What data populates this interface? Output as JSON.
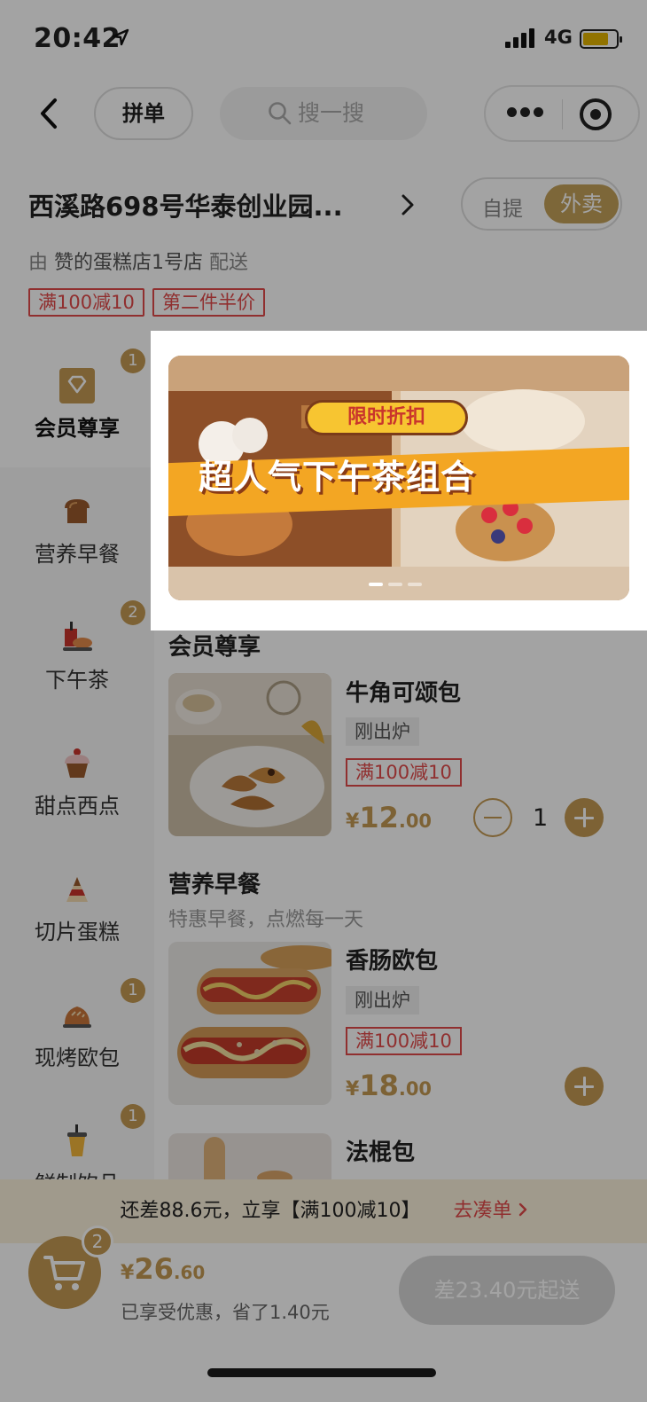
{
  "status_bar": {
    "time": "20:42",
    "network": "4G"
  },
  "nav": {
    "group_order_label": "拼单",
    "search_placeholder": "搜一搜"
  },
  "store": {
    "address": "西溪路698号华泰创业园...",
    "mode_self": "自提",
    "mode_delivery": "外卖",
    "delivery_prefix": "由",
    "shop_name": "赞的蛋糕店1号店",
    "delivery_suffix": "配送",
    "promos": [
      "满100减10",
      "第二件半价"
    ]
  },
  "banner": {
    "tag": "限时折扣",
    "headline": "超人气下午茶组合"
  },
  "categories": [
    {
      "label": "会员尊享",
      "badge": "1",
      "icon": "diamond-icon",
      "active": true
    },
    {
      "label": "营养早餐",
      "badge": "",
      "icon": "bread-icon",
      "active": false
    },
    {
      "label": "下午茶",
      "badge": "2",
      "icon": "afternoon-tea-icon",
      "active": false
    },
    {
      "label": "甜点西点",
      "badge": "",
      "icon": "cupcake-icon",
      "active": false
    },
    {
      "label": "切片蛋糕",
      "badge": "",
      "icon": "cake-slice-icon",
      "active": false
    },
    {
      "label": "现烤欧包",
      "badge": "1",
      "icon": "baked-bread-icon",
      "active": false
    },
    {
      "label": "鲜制饮品",
      "badge": "1",
      "icon": "drink-cup-icon",
      "active": false
    }
  ],
  "sections": [
    {
      "title": "会员尊享",
      "products": [
        {
          "name": "牛角可颂包",
          "tag": "刚出炉",
          "promo": "满100减10",
          "price_int": "12",
          "price_dec": ".00",
          "qty": "1"
        }
      ]
    },
    {
      "title": "营养早餐",
      "subtitle": "特惠早餐，点燃每一天",
      "products": [
        {
          "name": "香肠欧包",
          "tag": "刚出炉",
          "promo": "满100减10",
          "price_int": "18",
          "price_dec": ".00"
        },
        {
          "name": "法棍包"
        }
      ]
    }
  ],
  "currency": "¥",
  "cart": {
    "tip_text": "还差88.6元，立享【满100减10】",
    "tip_action": "去凑单",
    "count": "2",
    "total_int": "26",
    "total_dec": ".60",
    "saved_text": "已享受优惠，省了1.40元",
    "checkout_label": "差23.40元起送"
  },
  "colors": {
    "accent": "#c49a53",
    "promo_red": "#e24a4a"
  }
}
